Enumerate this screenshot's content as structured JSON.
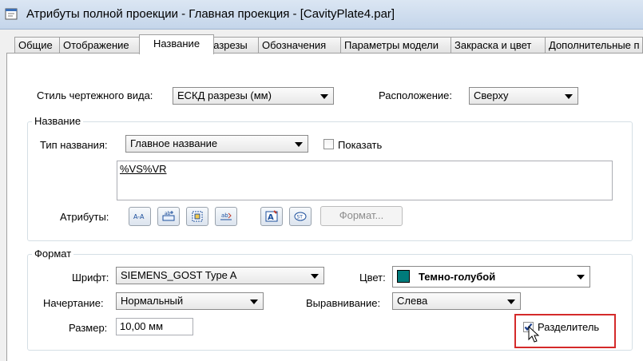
{
  "window": {
    "title": "Атрибуты полной проекции - Главная проекция - [CavityPlate4.par]"
  },
  "tabs": [
    {
      "label": "Общие"
    },
    {
      "label": "Отображение"
    },
    {
      "label": "Название"
    },
    {
      "label": "Разрезы"
    },
    {
      "label": "Обозначения"
    },
    {
      "label": "Параметры модели"
    },
    {
      "label": "Закраска и цвет"
    },
    {
      "label": "Дополнительные п"
    }
  ],
  "top_row": {
    "style_label": "Стиль чертежного вида:",
    "style_value": "ЕСКД разрезы (мм)",
    "position_label": "Расположение:",
    "position_value": "Сверху"
  },
  "name_group": {
    "title": "Название",
    "type_label": "Тип названия:",
    "type_value": "Главное название",
    "show_label": "Показать",
    "show_checked": false,
    "text_value": "%VS%VR",
    "attributes_label": "Атрибуты:",
    "attribute_icons": [
      "section-label-icon",
      "insert-property-icon",
      "table-field-icon",
      "underline-field-icon",
      "text-format-icon",
      "symbol-icon"
    ],
    "format_button": "Формат..."
  },
  "format_group": {
    "title": "Формат",
    "font_label": "Шрифт:",
    "font_value": "SIEMENS_GOST Type A",
    "color_label": "Цвет:",
    "color_value": "Темно-голубой",
    "color_hex": "#007b7b",
    "style_label": "Начертание:",
    "style_value": "Нормальный",
    "align_label": "Выравнивание:",
    "align_value": "Слева",
    "size_label": "Размер:",
    "size_value": "10,00 мм",
    "separator_label": "Разделитель",
    "separator_checked": true
  },
  "highlight_color": "#d42a2a"
}
